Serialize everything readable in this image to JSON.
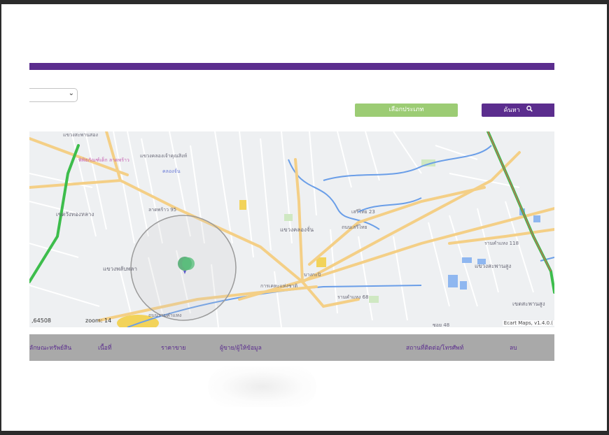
{
  "toolbar": {
    "select_value": "",
    "type_button_label": "เลือกประเภท",
    "search_button_label": "ค้นหา",
    "search_icon": "magnifier-icon"
  },
  "map": {
    "coordinate_readout": ",64508",
    "zoom_readout": "zoom: 14",
    "credit": "Ecart Maps, v1.4.0.(",
    "labels": {
      "l1": "แขวงสะพานสอง",
      "l2": "แขวงคลองเจ้าคุณสิงห์",
      "l3": "พิพิธภัณฑ์เด็ก ลาดพร้าว",
      "l4": "คลองจั่น",
      "l5": "เขตวังทองหลาง",
      "l6": "ลาดพร้าว 95",
      "l7": "แขวงคลองจั่น",
      "l8": "แขวงพลับพลา",
      "l9": "ถนนรามคำแหง",
      "l10": "เสรีไทย 23",
      "l11": "แขวงสะพานสูง",
      "l12": "เขตสะพานสูง",
      "l13": "การเคหะแห่งชาติ",
      "l14": "ถนนเสรีไทย",
      "l15": "บางกะปิ",
      "l16": "ซอย 48",
      "l17": "รามคำแหง 68",
      "l18": "รามคำแหง 118"
    },
    "colors": {
      "highway": "#3dbd4c",
      "main_road": "#f4cf86",
      "water": "#6a9ee8",
      "marker": "#4aa86c"
    }
  },
  "table": {
    "headers": [
      "ลักษณะทรัพย์สิน",
      "เนื้อที่",
      "ราคาขาย",
      "ผู้ขาย/ผู้ให้ข้อมูล",
      "สถานที่ติดต่อ/โทรศัพท์",
      "ลบ"
    ]
  }
}
